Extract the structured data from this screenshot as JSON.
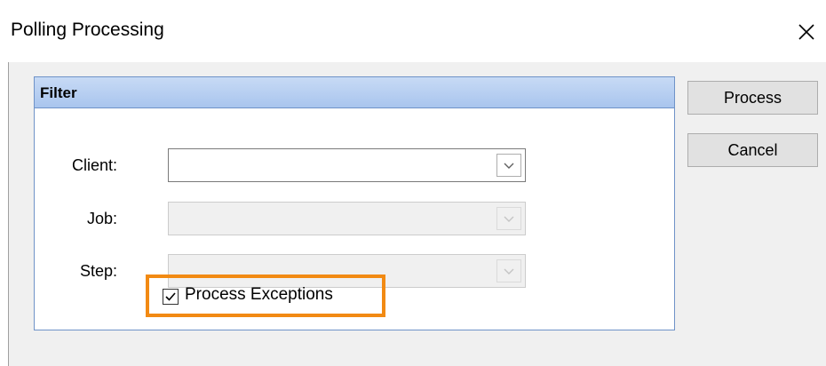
{
  "window": {
    "title": "Polling Processing",
    "close_icon": "close-icon"
  },
  "filter": {
    "title": "Filter",
    "client_label": "Client:",
    "job_label": "Job:",
    "step_label": "Step:",
    "client_value": "",
    "job_value": "",
    "step_value": "",
    "process_exceptions_label": "Process Exceptions",
    "process_exceptions_checked": true
  },
  "buttons": {
    "process": "Process",
    "cancel": "Cancel"
  },
  "colors": {
    "highlight_border": "#f28a13",
    "group_header": "#a9c5ee",
    "client_area": "#f0f0f0"
  }
}
